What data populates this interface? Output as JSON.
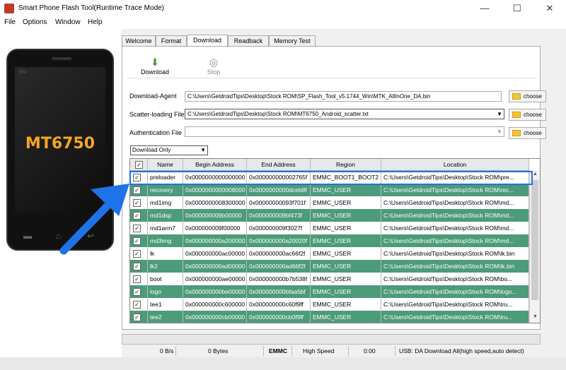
{
  "window": {
    "title": "Smart Phone Flash Tool(Runtime Trace Mode)",
    "minimize": "—",
    "maximize": "☐",
    "close": "✕"
  },
  "menu": [
    "File",
    "Options",
    "Window",
    "Help"
  ],
  "phone": {
    "brand": "BM",
    "model": "MT6750"
  },
  "tabs": [
    "Welcome",
    "Format",
    "Download",
    "Readback",
    "Memory Test"
  ],
  "active_tab": "Download",
  "toolbar": {
    "download_label": "Download",
    "stop_label": "Stop"
  },
  "fields": {
    "download_agent": {
      "label": "Download-Agent",
      "value": "C:\\Users\\GetdroidTips\\Desktop\\Stock ROM\\SP_Flash_Tool_v5.1744_Win\\MTK_AllInOne_DA.bin"
    },
    "scatter": {
      "label": "Scatter-loading File",
      "value": "C:\\Users\\GetdroidTips\\Desktop\\Stock ROM\\MT6750_Android_scatter.txt"
    },
    "auth": {
      "label": "Authentication File",
      "value": ""
    },
    "choose_label": "choose"
  },
  "mode_select": "Download Only",
  "table": {
    "columns": [
      "Name",
      "Begin Address",
      "End Address",
      "Region",
      "Location"
    ],
    "rows": [
      {
        "name": "preloader",
        "begin": "0x0000000000000000",
        "end": "0x000000000002765f",
        "region": "EMMC_BOOT1_BOOT2",
        "location": "C:\\Users\\GetdroidTips\\Desktop\\Stock ROM\\pre..."
      },
      {
        "name": "recovery",
        "begin": "0x0000000000008000",
        "end": "0x0000000000dceb8f",
        "region": "EMMC_USER",
        "location": "C:\\Users\\GetdroidTips\\Desktop\\Stock ROM\\rec..."
      },
      {
        "name": "md1img",
        "begin": "0x0000000008300000",
        "end": "0x00000000093f701f",
        "region": "EMMC_USER",
        "location": "C:\\Users\\GetdroidTips\\Desktop\\Stock ROM\\md..."
      },
      {
        "name": "md1dsp",
        "begin": "0x000000009b00000",
        "end": "0x000000009bf473f",
        "region": "EMMC_USER",
        "location": "C:\\Users\\GetdroidTips\\Desktop\\Stock ROM\\md..."
      },
      {
        "name": "md1arm7",
        "begin": "0x000000009f00000",
        "end": "0x000000009f3027f",
        "region": "EMMC_USER",
        "location": "C:\\Users\\GetdroidTips\\Desktop\\Stock ROM\\md..."
      },
      {
        "name": "md3img",
        "begin": "0x000000000a200000",
        "end": "0x000000000a20020f",
        "region": "EMMC_USER",
        "location": "C:\\Users\\GetdroidTips\\Desktop\\Stock ROM\\md..."
      },
      {
        "name": "lk",
        "begin": "0x000000000ac00000",
        "end": "0x000000000ac66f2f",
        "region": "EMMC_USER",
        "location": "C:\\Users\\GetdroidTips\\Desktop\\Stock ROM\\lk.bin"
      },
      {
        "name": "lk2",
        "begin": "0x000000000ad00000",
        "end": "0x000000000ad66f2f",
        "region": "EMMC_USER",
        "location": "C:\\Users\\GetdroidTips\\Desktop\\Stock ROM\\lk.bin"
      },
      {
        "name": "boot",
        "begin": "0x000000000ae00000",
        "end": "0x000000000b7b538f",
        "region": "EMMC_USER",
        "location": "C:\\Users\\GetdroidTips\\Desktop\\Stock ROM\\bo..."
      },
      {
        "name": "logo",
        "begin": "0x000000000be00000",
        "end": "0x000000000bfaa5bf",
        "region": "EMMC_USER",
        "location": "C:\\Users\\GetdroidTips\\Desktop\\Stock ROM\\logo..."
      },
      {
        "name": "tee1",
        "begin": "0x000000000c600000",
        "end": "0x000000000c60f9ff",
        "region": "EMMC_USER",
        "location": "C:\\Users\\GetdroidTips\\Desktop\\Stock ROM\\tru..."
      },
      {
        "name": "tee2",
        "begin": "0x000000000cb00000",
        "end": "0x000000000cb0f9ff",
        "region": "EMMC_USER",
        "location": "C:\\Users\\GetdroidTips\\Desktop\\Stock ROM\\tru..."
      }
    ]
  },
  "status": {
    "speed": "0 B/s",
    "bytes": "0 Bytes",
    "storage": "EMMC",
    "usb_speed": "High Speed",
    "time": "0:00",
    "message": "USB: DA Download All(high speed,auto detect)"
  },
  "colors": {
    "green_row": "#4c9b7a",
    "highlight": "#1e73e8",
    "arrow": "#1e73e8"
  }
}
